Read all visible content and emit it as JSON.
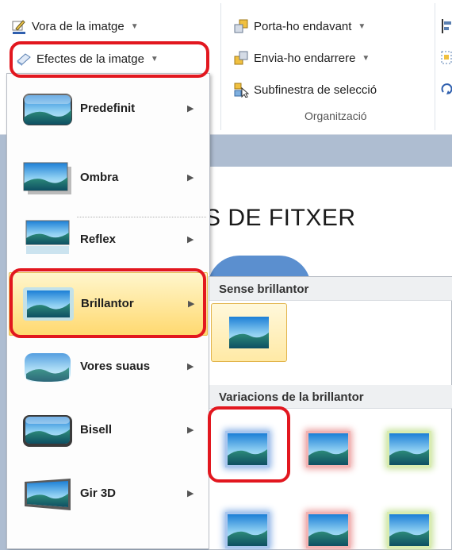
{
  "ribbon": {
    "border_label": "Vora de la imatge",
    "effects_label": "Efectes de la imatge",
    "bring_forward_label": "Porta-ho endavant",
    "send_backward_label": "Envia-ho endarrere",
    "selection_pane_label": "Subfinestra de selecció",
    "group_label": "Organització"
  },
  "slide": {
    "title_fragment": "S DE FITXER"
  },
  "effects_menu": {
    "items": [
      {
        "label": "Predefinit",
        "icon": "preset-effect-icon"
      },
      {
        "label": "Ombra",
        "icon": "shadow-effect-icon"
      },
      {
        "label": "Reflex",
        "icon": "reflection-effect-icon"
      },
      {
        "label": "Brillantor",
        "icon": "glow-effect-icon"
      },
      {
        "label": "Vores suaus",
        "icon": "soft-edges-effect-icon"
      },
      {
        "label": "Bisell",
        "icon": "bevel-effect-icon"
      },
      {
        "label": "Gir 3D",
        "icon": "rotation-3d-effect-icon"
      }
    ]
  },
  "glow_submenu": {
    "no_glow_header": "Sense brillantor",
    "variations_header": "Variacions de la brillantor",
    "glow_colors": [
      "#8db3e6",
      "#eba0a0",
      "#c6e29a"
    ]
  },
  "annotation_color": "#e2171f"
}
